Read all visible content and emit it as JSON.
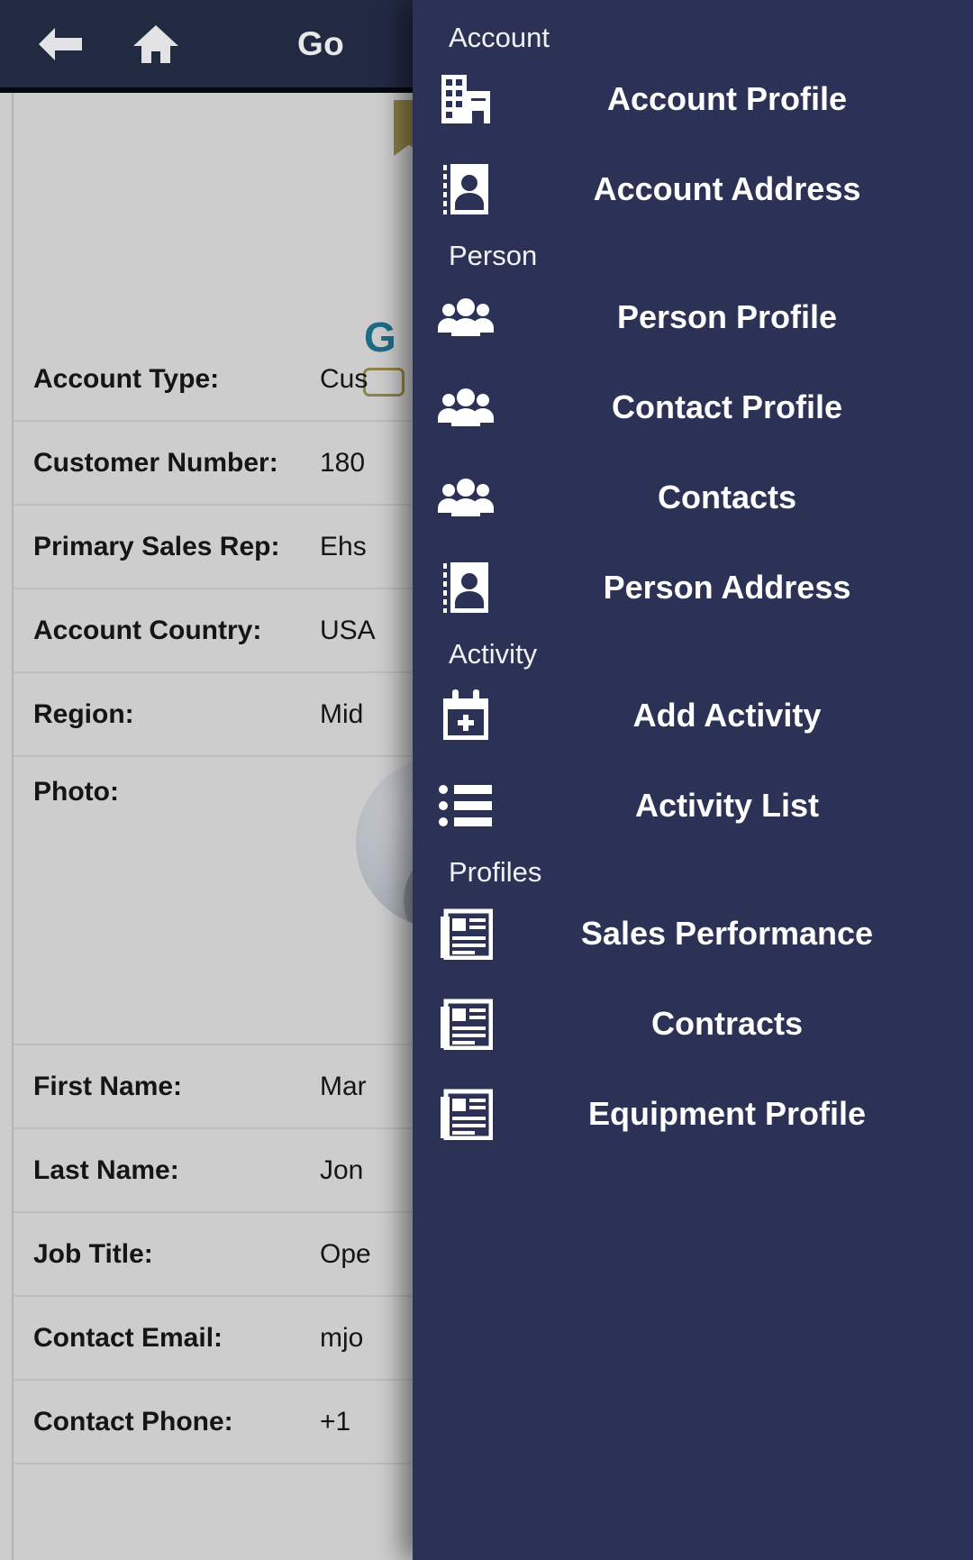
{
  "appbar": {
    "back_icon": "arrow-left-icon",
    "home_icon": "home-icon",
    "title": "Go"
  },
  "record": {
    "logo_fragment": "G",
    "fields": [
      {
        "label": "Account Type:",
        "value": "Cus"
      },
      {
        "label": "Customer Number:",
        "value": "180"
      },
      {
        "label": "Primary Sales Rep:",
        "value": "Ehs"
      },
      {
        "label": "Account Country:",
        "value": "USA"
      },
      {
        "label": "Region:",
        "value": "Mid"
      },
      {
        "label": "Photo:",
        "value": ""
      },
      {
        "label": "First Name:",
        "value": "Mar"
      },
      {
        "label": "Last Name:",
        "value": "Jon"
      },
      {
        "label": "Job Title:",
        "value": "Ope"
      },
      {
        "label": "Contact Email:",
        "value": "mjo"
      },
      {
        "label": "Contact Phone:",
        "value": "+1"
      }
    ]
  },
  "drawer": {
    "sections": [
      {
        "title": "Account",
        "items": [
          {
            "label": "Account Profile",
            "icon": "office-building-icon"
          },
          {
            "label": "Account Address",
            "icon": "contact-card-icon"
          }
        ]
      },
      {
        "title": "Person",
        "items": [
          {
            "label": "Person Profile",
            "icon": "people-group-icon"
          },
          {
            "label": "Contact Profile",
            "icon": "people-group-icon"
          },
          {
            "label": "Contacts",
            "icon": "people-group-icon"
          },
          {
            "label": "Person Address",
            "icon": "contact-card-icon"
          }
        ]
      },
      {
        "title": "Activity",
        "items": [
          {
            "label": "Add Activity",
            "icon": "calendar-plus-icon"
          },
          {
            "label": "Activity List",
            "icon": "bulleted-list-icon"
          }
        ]
      },
      {
        "title": "Profiles",
        "items": [
          {
            "label": "Sales Performance",
            "icon": "newspaper-icon"
          },
          {
            "label": "Contracts",
            "icon": "newspaper-icon"
          },
          {
            "label": "Equipment Profile",
            "icon": "newspaper-icon"
          }
        ]
      }
    ]
  },
  "colors": {
    "appbar": "#222a42",
    "drawer": "#2b3255",
    "content_bg": "#cdcdcd",
    "bookmark_gold": "#8d8247",
    "logo_teal": "#1e6b86"
  }
}
